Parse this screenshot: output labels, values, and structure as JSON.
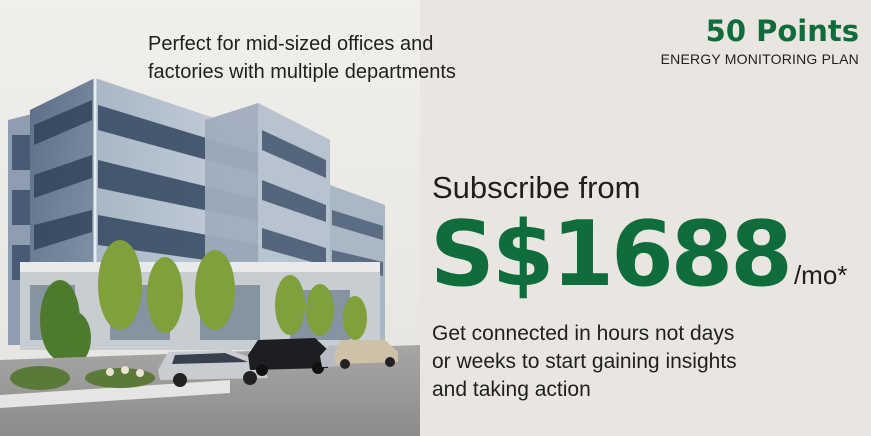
{
  "tagline": {
    "line1": "Perfect for mid-sized offices and",
    "line2": "factories with multiple departments"
  },
  "plan": {
    "points": "50 Points",
    "name": "ENERGY MONITORING PLAN"
  },
  "offer": {
    "subscribe_label": "Subscribe from",
    "price": "S$1688",
    "period": "/mo*"
  },
  "description": {
    "line1": "Get connected in hours not days",
    "line2": "or weeks to start gaining insights",
    "line3": "and taking action"
  },
  "colors": {
    "accent": "#0f6d3c",
    "background": "#e9e6e1",
    "text": "#1f1f1f"
  }
}
